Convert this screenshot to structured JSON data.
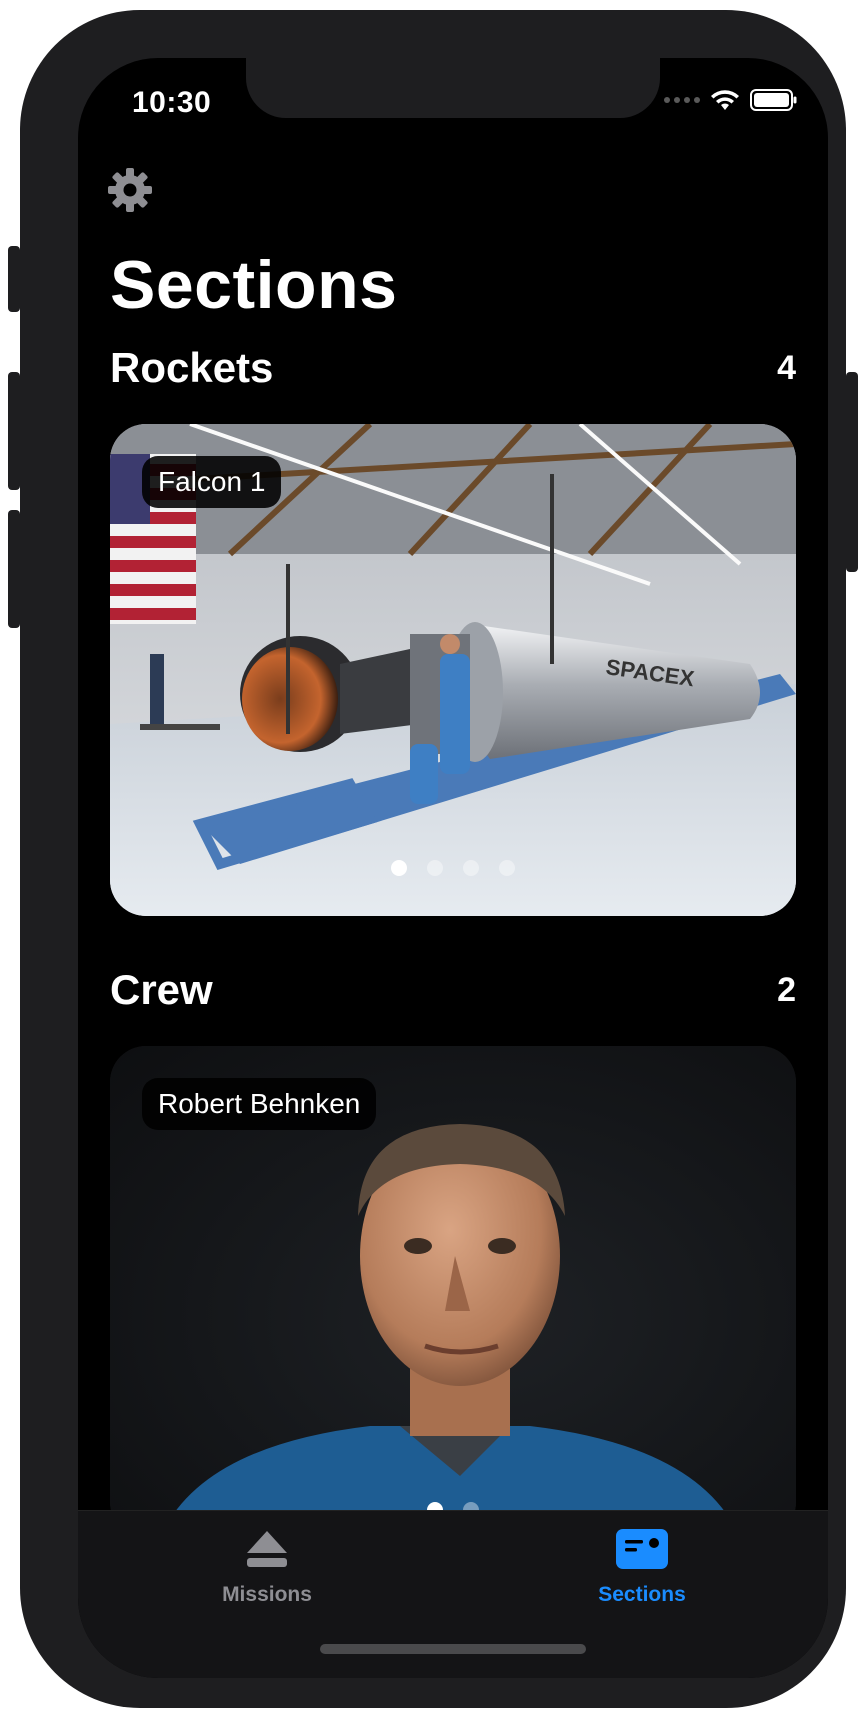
{
  "status": {
    "time": "10:30"
  },
  "nav": {
    "large_title": "Sections"
  },
  "sections": [
    {
      "title": "Rockets",
      "count": "4",
      "card": {
        "caption": "Falcon 1",
        "page_count": 4,
        "active_page": 1
      }
    },
    {
      "title": "Crew",
      "count": "2",
      "card": {
        "caption": "Robert Behnken",
        "page_count": 2,
        "active_page": 1
      }
    }
  ],
  "tabbar": {
    "items": [
      {
        "label": "Missions",
        "icon": "eject-icon",
        "selected": false
      },
      {
        "label": "Sections",
        "icon": "id-card-icon",
        "selected": true
      }
    ]
  },
  "colors": {
    "accent": "#1a8cff",
    "inactive_tab": "#8e8e93",
    "background": "#000000",
    "pill": "#000000"
  }
}
